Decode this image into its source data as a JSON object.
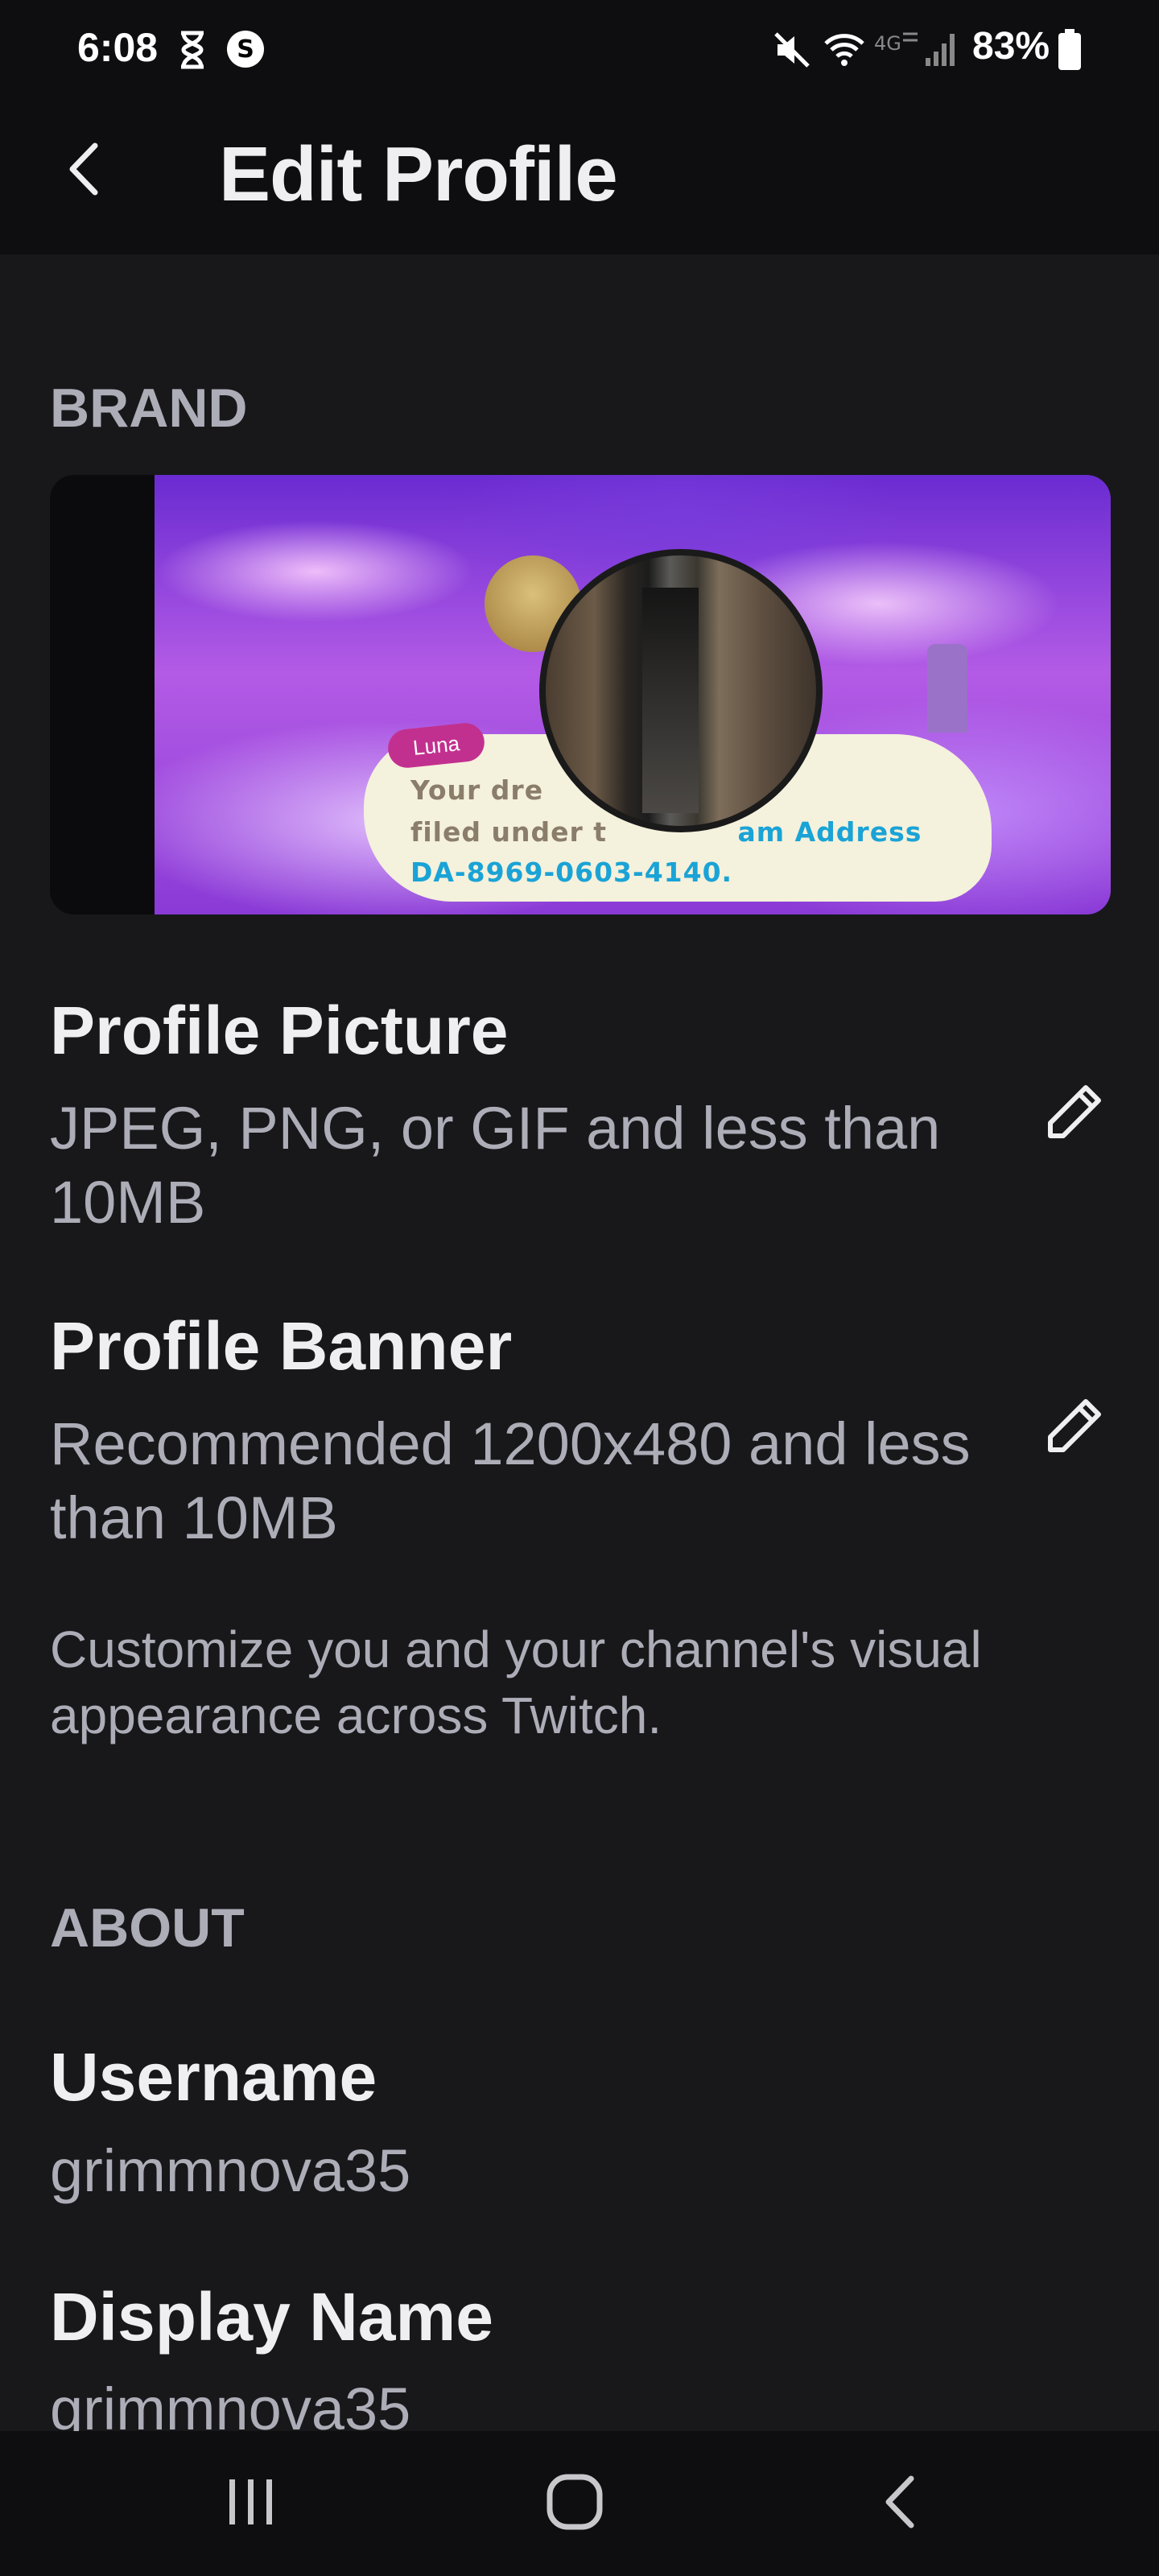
{
  "status_bar": {
    "time": "6:08",
    "battery": "83%",
    "icons": [
      "hourglass-icon",
      "s-app-icon",
      "mute-icon",
      "wifi-icon",
      "lte-icon",
      "signal-icon",
      "battery-icon"
    ]
  },
  "header": {
    "title": "Edit Profile",
    "back_icon": "back-arrow-icon"
  },
  "brand": {
    "section_title": "BRAND",
    "banner": {
      "speaker": "Luna",
      "line1": "Your dre",
      "line2": "filed under t",
      "line2_highlight": "am Address",
      "line3": "DA-8969-0603-4140."
    },
    "profile_picture": {
      "title": "Profile Picture",
      "subtitle": "JPEG, PNG, or GIF and less than 10MB",
      "icon": "pencil-icon"
    },
    "profile_banner": {
      "title": "Profile Banner",
      "subtitle": "Recommended 1200x480 and less than 10MB",
      "icon": "pencil-icon"
    },
    "description": "Customize you and your channel's visual appearance across Twitch."
  },
  "about": {
    "section_title": "ABOUT",
    "username_label": "Username",
    "username_value": "grimmnova35",
    "display_name_label": "Display Name",
    "display_name_value": "grimmnova35"
  },
  "nav_bar": {
    "icons": [
      "recents-icon",
      "home-icon",
      "back-icon"
    ]
  },
  "colors": {
    "background": "#18181b",
    "header": "#0e0e10",
    "text_primary": "#efeff1",
    "text_secondary": "#adadb8",
    "dialog_highlight": "#1aa3d6"
  }
}
